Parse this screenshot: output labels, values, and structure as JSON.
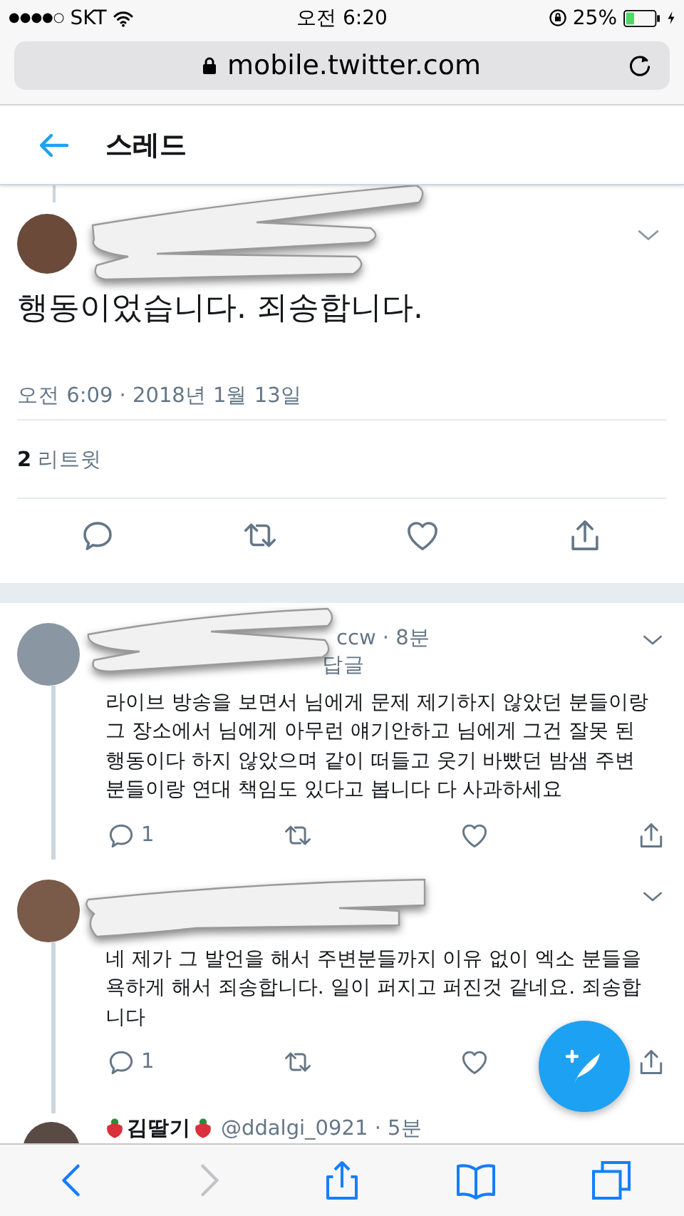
{
  "status_bar": {
    "signal": "●●●●○",
    "carrier": "SKT",
    "time": "오전 6:20",
    "battery": "25%"
  },
  "url_bar": {
    "url": "mobile.twitter.com"
  },
  "header": {
    "title": "스레드"
  },
  "main_tweet": {
    "author_redacted": true,
    "text": "행동이었습니다. 죄송합니다.",
    "timestamp": "오전 6:09 · 2018년 1월 13일",
    "retweet_count": "2",
    "retweet_label": "리트윗"
  },
  "replies": [
    {
      "author_redacted": true,
      "meta": "ccw · 8분",
      "reply_to": "답글",
      "text": "라이브 방송을 보면서 님에게 문제 제기하지 않았던 분들이랑 그 장소에서 님에게 아무런 얘기안하고 님에게 그건 잘못 된 행동이다 하지 않았으며 같이 떠들고 웃기 바빴던 밤샘 주변 분들이랑 연대 책임도 있다고 봅니다 다 사과하세요",
      "reply_count": "1"
    },
    {
      "author_redacted": true,
      "text": "네 제가 그 발언을 해서 주변분들까지 이유 없이 엑소 분들을 욕하게 해서 죄송합니다. 일이 퍼지고 퍼진것 같네요. 죄송합니다",
      "reply_count": "1"
    }
  ],
  "next_tweet": {
    "name": "김딸기",
    "meta": "@ddalgi_0921 · 5분"
  },
  "toolbar": {
    "buttons": [
      {
        "kind": "back",
        "disabled": false
      },
      {
        "kind": "forward",
        "disabled": true
      },
      {
        "kind": "share",
        "disabled": false
      },
      {
        "kind": "bookmarks",
        "disabled": false
      },
      {
        "kind": "tabs",
        "disabled": false
      }
    ]
  }
}
